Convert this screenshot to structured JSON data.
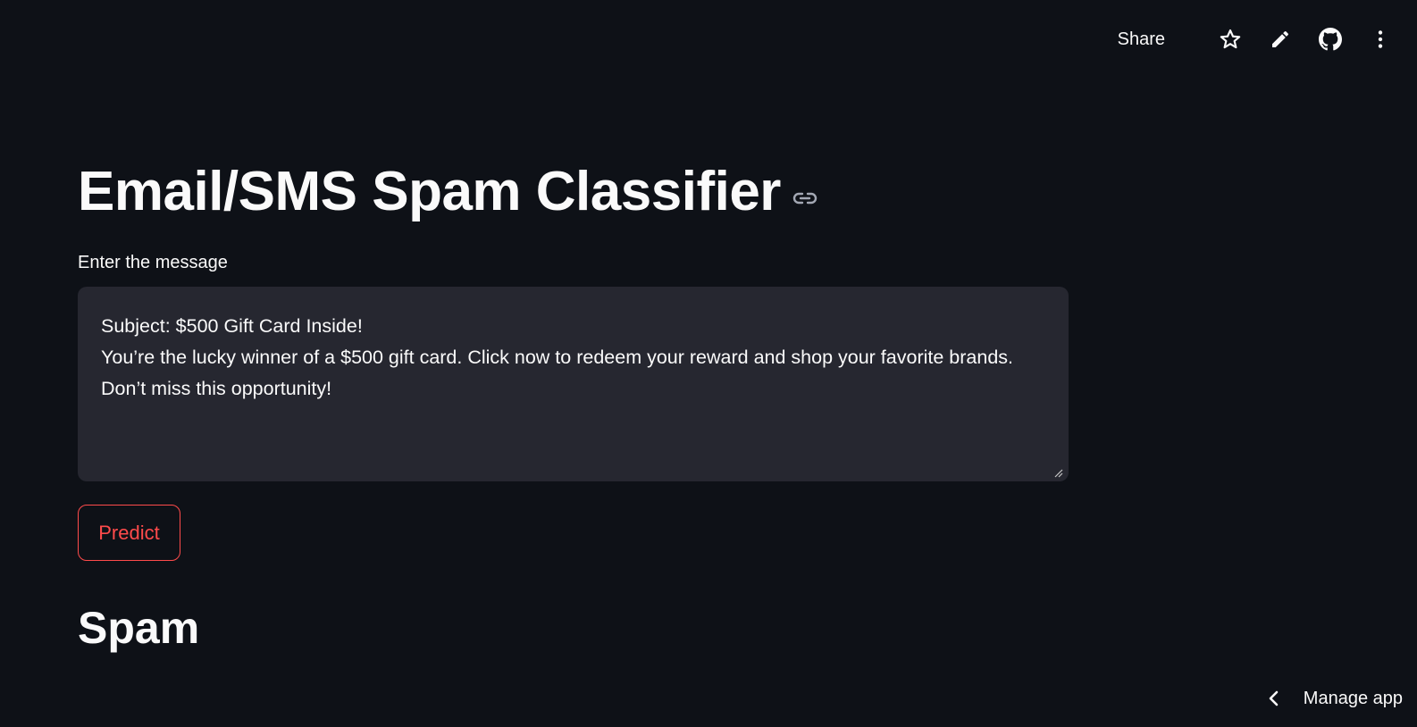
{
  "toolbar": {
    "share_label": "Share",
    "icons": [
      "star-icon",
      "pencil-icon",
      "github-icon",
      "more-vert-icon"
    ]
  },
  "main": {
    "title": "Email/SMS Spam Classifier",
    "input_label": "Enter the message",
    "message_value": "Subject: $500 Gift Card Inside!\nYou’re the lucky winner of a $500 gift card. Click now to redeem your reward and shop your favorite brands. Don’t miss this opportunity!",
    "predict_label": "Predict",
    "result": "Spam"
  },
  "footer": {
    "manage_label": "Manage app"
  },
  "colors": {
    "background": "#0e1117",
    "input_bg": "#262730",
    "accent": "#ff4b4b",
    "text": "#fafafa"
  }
}
